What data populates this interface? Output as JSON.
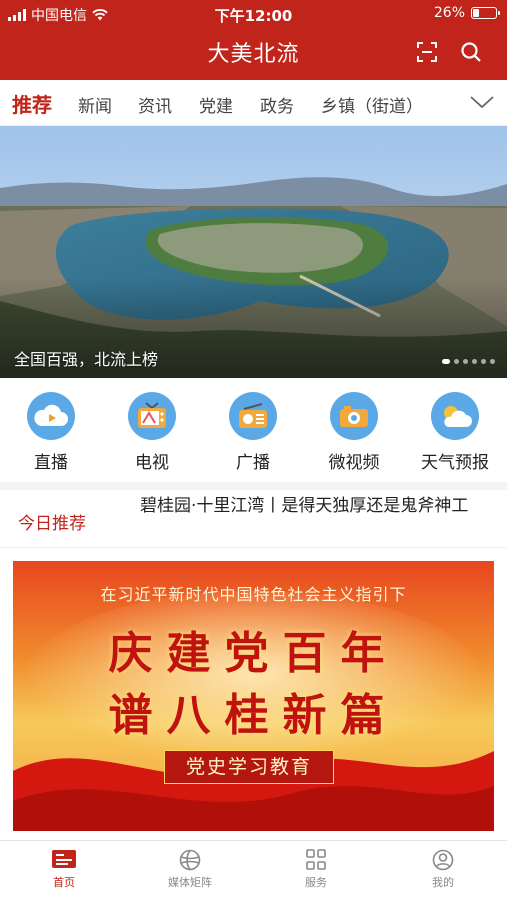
{
  "status_bar": {
    "carrier": "中国电信",
    "time": "下午12:00",
    "battery_percent": "26%",
    "battery_level": 0.26
  },
  "header": {
    "title": "大美北流",
    "icons": [
      "scan-icon",
      "search-icon"
    ],
    "brand_color": "#c0241a"
  },
  "tabs": [
    "推荐",
    "新闻",
    "资讯",
    "党建",
    "政务",
    "乡镇（街道）"
  ],
  "active_tab": "推荐",
  "banner": {
    "caption": "全国百强，北流上榜",
    "dot_count": 6,
    "active_dot": 0
  },
  "quick_links": [
    {
      "label": "直播",
      "icon": "live-icon",
      "color": "#3a9be0"
    },
    {
      "label": "电视",
      "icon": "tv-icon",
      "color": "#3a9be0"
    },
    {
      "label": "广播",
      "icon": "radio-icon",
      "color": "#3a9be0"
    },
    {
      "label": "微视频",
      "icon": "camera-icon",
      "color": "#3a9be0"
    },
    {
      "label": "天气预报",
      "icon": "weather-icon",
      "color": "#3a9be0"
    }
  ],
  "today": {
    "tag": "今日推荐",
    "headline": "碧桂园·十里江湾丨是得天独厚还是鬼斧神工"
  },
  "poster": {
    "subtitle": "在习近平新时代中国特色社会主义指引下",
    "line1": "庆建党百年",
    "line2": "谱八桂新篇",
    "badge": "党史学习教育"
  },
  "tab_bar": [
    {
      "label": "首页",
      "icon": "home-icon",
      "active": true
    },
    {
      "label": "媒体矩阵",
      "icon": "media-matrix-icon",
      "active": false
    },
    {
      "label": "服务",
      "icon": "services-grid-icon",
      "active": false
    },
    {
      "label": "我的",
      "icon": "profile-icon",
      "active": false
    }
  ]
}
